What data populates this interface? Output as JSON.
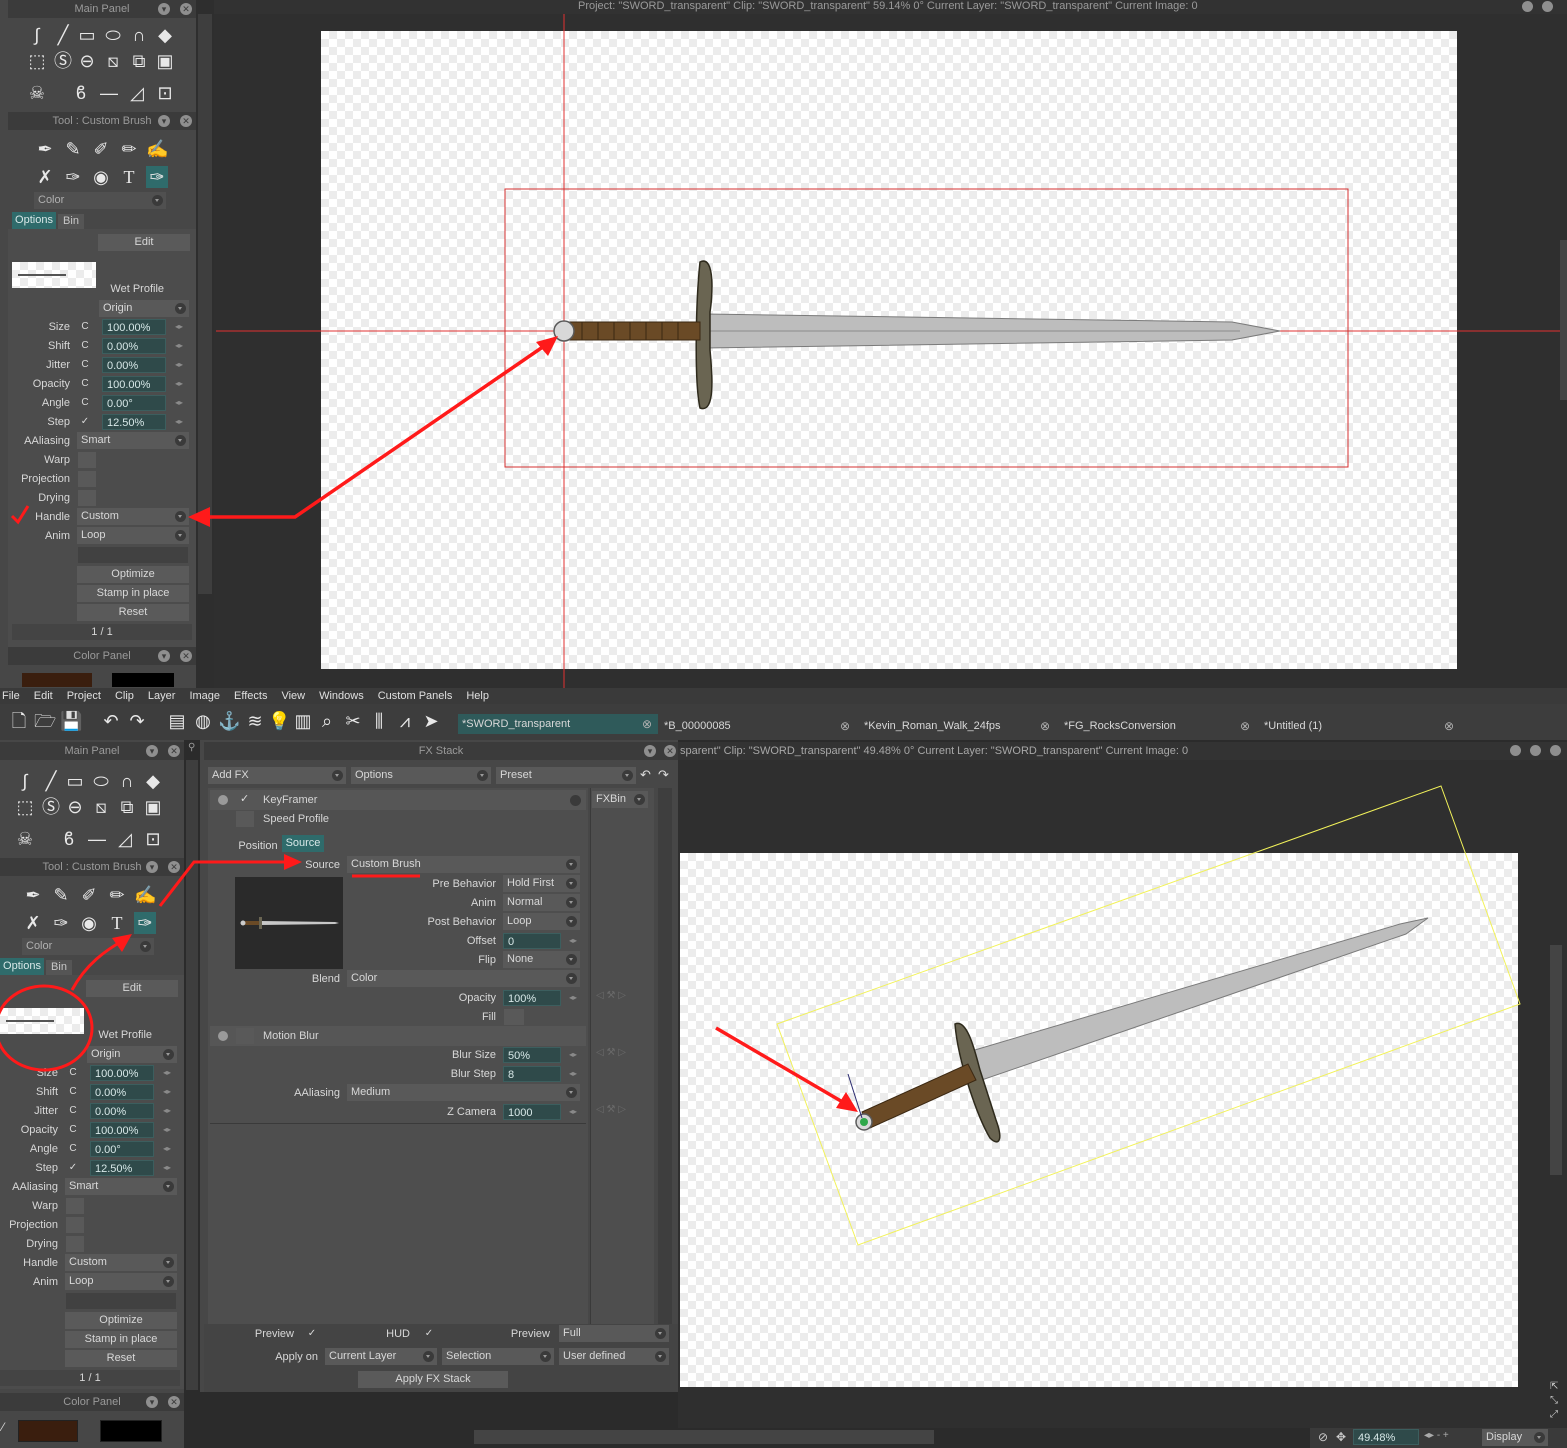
{
  "top": {
    "status_title": "Project: \"SWORD_transparent\" Clip: \"SWORD_transparent\"   59.14%   0°  Current Layer: \"SWORD_transparent\"  Current Image: 0",
    "main_panel_title": "Main Panel",
    "tool_panel_title": "Tool : Custom Brush",
    "color_dropdown": "Color",
    "tab_options": "Options",
    "tab_bin": "Bin",
    "edit_button": "Edit",
    "wet_profile": "Wet Profile",
    "origin": "Origin",
    "params": [
      {
        "label": "Size",
        "mode": "C",
        "value": "100.00%"
      },
      {
        "label": "Shift",
        "mode": "C",
        "value": "0.00%"
      },
      {
        "label": "Jitter",
        "mode": "C",
        "value": "0.00%"
      },
      {
        "label": "Opacity",
        "mode": "C",
        "value": "100.00%"
      },
      {
        "label": "Angle",
        "mode": "C",
        "value": "0.00°"
      },
      {
        "label": "Step",
        "mode": "✓",
        "value": "12.50%"
      }
    ],
    "aaliasing_label": "AAliasing",
    "aaliasing_value": "Smart",
    "warp_label": "Warp",
    "projection_label": "Projection",
    "drying_label": "Drying",
    "handle_label": "Handle",
    "handle_value": "Custom",
    "anim_label": "Anim",
    "anim_value": "Loop",
    "optimize": "Optimize",
    "stamp": "Stamp in place",
    "reset": "Reset",
    "page": "1 / 1",
    "color_panel_title": "Color Panel"
  },
  "menu": [
    "File",
    "Edit",
    "Project",
    "Clip",
    "Layer",
    "Image",
    "Effects",
    "View",
    "Windows",
    "Custom Panels",
    "Help"
  ],
  "doc_tabs": [
    "*SWORD_transparent",
    "*B_00000085",
    "*Kevin_Roman_Walk_24fps",
    "*FG_RocksConversion",
    "*Untitled (1)"
  ],
  "bottom": {
    "status_title": "sparent\"  Clip: \"SWORD_transparent\"  49.48%   0°  Current Layer: \"SWORD_transparent\"  Current Image: 0",
    "main_panel_title": "Main Panel",
    "tool_panel_title": "Tool : Custom Brush",
    "color_dropdown": "Color",
    "tab_options": "Options",
    "tab_bin": "Bin",
    "edit_button": "Edit",
    "wet_profile": "Wet Profile",
    "origin": "Origin",
    "params": [
      {
        "label": "Size",
        "mode": "C",
        "value": "100.00%"
      },
      {
        "label": "Shift",
        "mode": "C",
        "value": "0.00%"
      },
      {
        "label": "Jitter",
        "mode": "C",
        "value": "0.00%"
      },
      {
        "label": "Opacity",
        "mode": "C",
        "value": "100.00%"
      },
      {
        "label": "Angle",
        "mode": "C",
        "value": "0.00°"
      },
      {
        "label": "Step",
        "mode": "✓",
        "value": "12.50%"
      }
    ],
    "aaliasing_label": "AAliasing",
    "aaliasing_value": "Smart",
    "warp_label": "Warp",
    "projection_label": "Projection",
    "drying_label": "Drying",
    "handle_label": "Handle",
    "handle_value": "Custom",
    "anim_label": "Anim",
    "anim_value": "Loop",
    "optimize": "Optimize",
    "stamp": "Stamp in place",
    "reset": "Reset",
    "page": "1 / 1",
    "color_panel_title": "Color Panel",
    "zoom": "49.48%",
    "display": "Display"
  },
  "fx": {
    "title": "FX Stack",
    "add_fx": "Add FX",
    "options": "Options",
    "preset": "Preset",
    "keyframer": "KeyFramer",
    "speed_profile": "Speed Profile",
    "fxbin": "FXBin",
    "tab_position": "Position",
    "tab_source": "Source",
    "source_label": "Source",
    "source_value": "Custom Brush",
    "rows": [
      {
        "label": "Pre Behavior",
        "value": "Hold First"
      },
      {
        "label": "Anim",
        "value": "Normal"
      },
      {
        "label": "Post Behavior",
        "value": "Loop"
      }
    ],
    "offset_label": "Offset",
    "offset_value": "0",
    "flip_label": "Flip",
    "flip_value": "None",
    "blend_label": "Blend",
    "blend_value": "Color",
    "opacity_label": "Opacity",
    "opacity_value": "100%",
    "fill_label": "Fill",
    "motion_blur": "Motion Blur",
    "blur_size_label": "Blur Size",
    "blur_size_value": "50%",
    "blur_step_label": "Blur Step",
    "blur_step_value": "8",
    "mb_aaliasing_label": "AAliasing",
    "mb_aaliasing_value": "Medium",
    "zcamera_label": "Z Camera",
    "zcamera_value": "1000",
    "preview_label": "Preview",
    "hud_label": "HUD",
    "preview2_label": "Preview",
    "preview2_value": "Full",
    "apply_on_label": "Apply on",
    "apply_on_value": "Current Layer",
    "selection_value": "Selection",
    "user_defined_value": "User defined",
    "apply_button": "Apply FX Stack"
  },
  "colors": {
    "annotation_red": "#ff1a1a",
    "bbox_yellow": "#f2f25a",
    "field_teal": "#2f4a4a",
    "panel_gray": "#4a4a4a"
  },
  "icons": [
    "pen-icon",
    "line-icon",
    "rect-icon",
    "ellipse-icon",
    "magnet-icon",
    "eraser-icon",
    "skull-icon",
    "brush-icon",
    "drop-icon",
    "text-icon",
    "undo-icon",
    "redo-icon",
    "new-icon",
    "open-icon",
    "save-icon",
    "close-icon",
    "sword-image"
  ]
}
